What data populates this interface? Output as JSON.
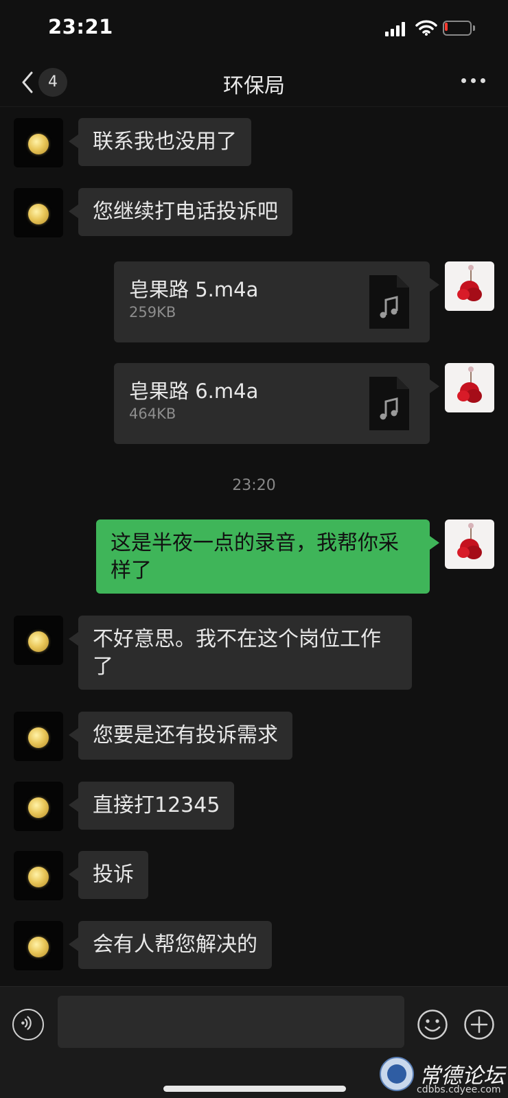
{
  "status_bar": {
    "time": "23:21",
    "battery_color": "#ff3b30",
    "battery_level": 0.1
  },
  "nav": {
    "back_icon": "chevron-left-icon",
    "unread_count": "4",
    "title": "环保局",
    "more_icon": "more-dots-icon"
  },
  "messages": [
    {
      "type": "text",
      "side": "left",
      "avatar": "moon",
      "text": "联系我也没用了"
    },
    {
      "type": "text",
      "side": "left",
      "avatar": "moon",
      "text": "您继续打电话投诉吧"
    },
    {
      "type": "file",
      "side": "right",
      "avatar": "rose",
      "file_name": "皂果路 5.m4a",
      "file_size": "259KB",
      "icon": "music-file-icon"
    },
    {
      "type": "file",
      "side": "right",
      "avatar": "rose",
      "file_name": "皂果路 6.m4a",
      "file_size": "464KB",
      "icon": "music-file-icon"
    },
    {
      "type": "time",
      "text": "23:20"
    },
    {
      "type": "text",
      "side": "right",
      "avatar": "rose",
      "text": "这是半夜一点的录音，我帮你采样了"
    },
    {
      "type": "text",
      "side": "left",
      "avatar": "moon",
      "text": "不好意思。我不在这个岗位工作了"
    },
    {
      "type": "text",
      "side": "left",
      "avatar": "moon",
      "text": "您要是还有投诉需求"
    },
    {
      "type": "text",
      "side": "left",
      "avatar": "moon",
      "text": "直接打12345"
    },
    {
      "type": "text",
      "side": "left",
      "avatar": "moon",
      "text": "投诉"
    },
    {
      "type": "text",
      "side": "left",
      "avatar": "moon",
      "text": "会有人帮您解决的"
    }
  ],
  "input_bar": {
    "voice_icon": "voice-icon",
    "input_value": "",
    "emoji_icon": "emoji-icon",
    "plus_icon": "plus-icon"
  },
  "watermark": {
    "title": "常德论坛",
    "url": "cdbbs.cdyee.com"
  },
  "colors": {
    "background": "#111111",
    "incoming_bubble": "#2c2c2c",
    "outgoing_bubble": "#3fb559"
  }
}
